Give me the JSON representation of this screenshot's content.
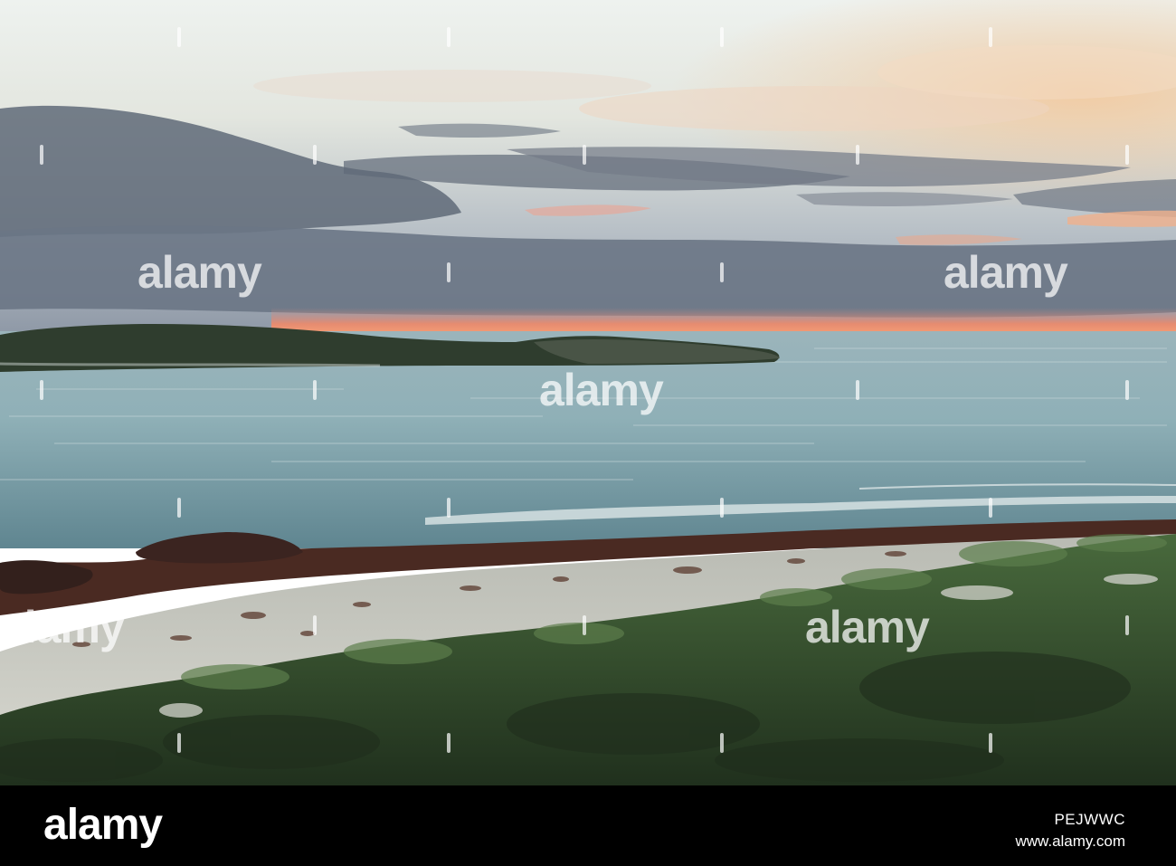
{
  "watermark": {
    "text": "alamy"
  },
  "footer": {
    "logo": "alamy",
    "image_id": "PEJWWC",
    "url": "www.alamy.com"
  },
  "colors": {
    "sky_top": "#e9eeec",
    "sky_mid": "#c9d2d4",
    "cloud_band": "#5f6a78",
    "sunset_glow": "#f08a6a",
    "sea": "#8aa9b2",
    "headland": "#2f3d2e",
    "seaweed": "#4a2a22",
    "sand": "#cfd0c8",
    "dune_scrub": "#3a5a34",
    "bar": "#000000"
  }
}
